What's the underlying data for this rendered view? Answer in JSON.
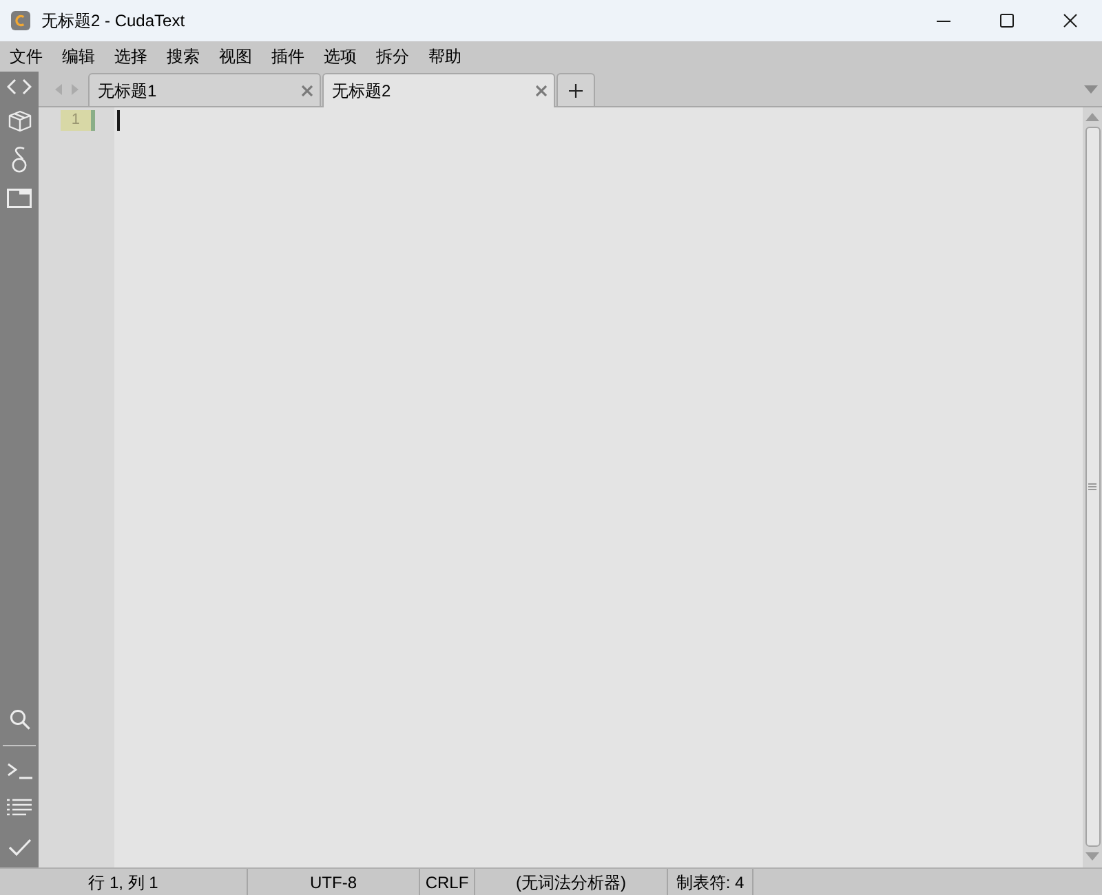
{
  "window": {
    "title": "无标题2 - CudaText"
  },
  "menu": [
    "文件",
    "编辑",
    "选择",
    "搜索",
    "视图",
    "插件",
    "选项",
    "拆分",
    "帮助"
  ],
  "tabs": [
    {
      "label": "无标题1",
      "selected": false
    },
    {
      "label": "无标题2",
      "selected": true
    }
  ],
  "editor": {
    "lines": [
      {
        "number": "1",
        "current": true,
        "modified": true
      }
    ]
  },
  "status_bar": [
    "行 1, 列 1",
    "UTF-8",
    "CRLF",
    "(无词法分析器)",
    "制表符: 4"
  ]
}
